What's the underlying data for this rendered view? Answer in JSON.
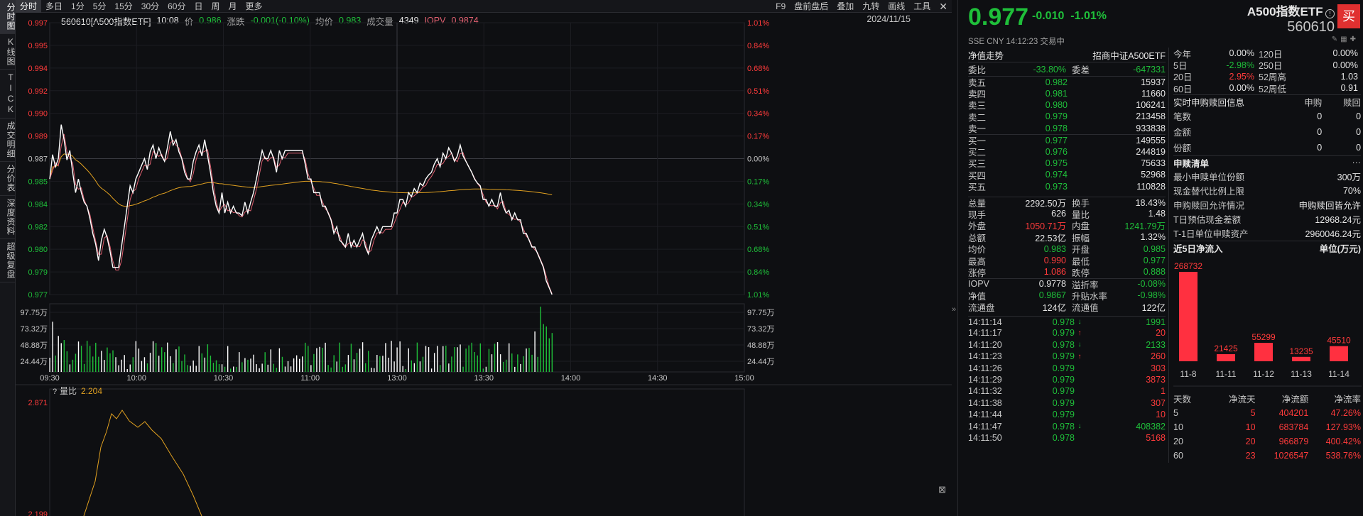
{
  "vtabs": [
    "分时图",
    "K线图",
    "TICK",
    "成交明细",
    "分价表",
    "深度资料",
    "超级复盘"
  ],
  "toolbar": {
    "left": [
      "分时",
      "多日",
      "1分",
      "5分",
      "15分",
      "30分",
      "60分",
      "日",
      "周",
      "月",
      "更多"
    ],
    "right": [
      "F9",
      "盘前盘后",
      "叠加",
      "九转",
      "画线",
      "工具"
    ],
    "close_icon": "close-icon"
  },
  "info": {
    "code_name": "560610[A500指数ETF]",
    "time": "10:08",
    "price_label": "价",
    "price": "0.986",
    "change_label": "涨跌",
    "change": "-0.001(-0.10%)",
    "avg_label": "均价",
    "avg": "0.983",
    "volume_label": "成交量",
    "volume": "4349",
    "iopv_label": "IOPV",
    "iopv": "0.9874",
    "date": "2024/11/15"
  },
  "chart_data": {
    "type": "line",
    "price_axis": [
      "0.997",
      "0.995",
      "0.994",
      "0.992",
      "0.990",
      "0.989",
      "0.987",
      "0.985",
      "0.984",
      "0.982",
      "0.980",
      "0.979",
      "0.977"
    ],
    "pct_axis": [
      "1.01%",
      "0.84%",
      "0.68%",
      "0.51%",
      "0.34%",
      "0.17%",
      "0.00%",
      "0.17%",
      "0.34%",
      "0.51%",
      "0.68%",
      "0.84%",
      "1.01%"
    ],
    "ylim": [
      0.977,
      0.997
    ],
    "prev_close": 0.987,
    "volume_axis": [
      "97.75万",
      "73.32万",
      "48.88万",
      "24.44万"
    ],
    "time_axis": [
      "09:30",
      "10:00",
      "10:30",
      "11:00",
      "13:00",
      "13:30",
      "14:00",
      "14:30",
      "15:00"
    ],
    "series": [
      {
        "name": "价格",
        "color": "#ffffff"
      },
      {
        "name": "IOPV",
        "color": "#e06070"
      },
      {
        "name": "均价",
        "color": "#e0a020"
      }
    ],
    "price": [
      0.9855,
      0.9873,
      0.9864,
      0.987,
      0.9895,
      0.9884,
      0.9869,
      0.9876,
      0.986,
      0.9845,
      0.9855,
      0.9845,
      0.9838,
      0.9835,
      0.9826,
      0.9815,
      0.9807,
      0.9795,
      0.981,
      0.9818,
      0.9812,
      0.9802,
      0.979,
      0.979,
      0.979,
      0.9805,
      0.982,
      0.9835,
      0.985,
      0.9845,
      0.9855,
      0.986,
      0.9865,
      0.987,
      0.9862,
      0.9875,
      0.988,
      0.987,
      0.9878,
      0.9872,
      0.9868,
      0.9878,
      0.989,
      0.988,
      0.9884,
      0.9875,
      0.987,
      0.986,
      0.9855,
      0.9855,
      0.9868,
      0.9875,
      0.988,
      0.9872,
      0.9884,
      0.9872,
      0.986,
      0.9845,
      0.9835,
      0.983,
      0.9845,
      0.983,
      0.9838,
      0.983,
      0.9835,
      0.983,
      0.983,
      0.9828,
      0.9838,
      0.983,
      0.9838,
      0.9845,
      0.9855,
      0.9866,
      0.9876,
      0.987,
      0.987,
      0.9876,
      0.987,
      0.986,
      0.9876,
      0.987,
      0.9876,
      0.9876,
      0.9876,
      0.9876,
      0.9876,
      0.9876,
      0.9876,
      0.9866,
      0.9855,
      0.9855,
      0.9845,
      0.9845,
      0.9845,
      0.9835,
      0.9835,
      0.983,
      0.9825,
      0.9815,
      0.982,
      0.981,
      0.9808,
      0.9805,
      0.9815,
      0.9805,
      0.981,
      0.9805,
      0.981,
      0.9815,
      0.9805,
      0.98,
      0.981,
      0.9815,
      0.982,
      0.9815,
      0.982,
      0.982,
      0.982,
      0.982,
      0.983,
      0.983,
      0.984,
      0.984,
      0.9835,
      0.9845,
      0.9842,
      0.9848,
      0.9845,
      0.9852,
      0.985,
      0.9855,
      0.9858,
      0.986,
      0.9866,
      0.987,
      0.9864,
      0.9874,
      0.987,
      0.9878,
      0.9874,
      0.9868,
      0.9872,
      0.988,
      0.9872,
      0.9868,
      0.9864,
      0.986,
      0.9855,
      0.9852,
      0.985,
      0.984,
      0.984,
      0.9835,
      0.984,
      0.9835,
      0.9835,
      0.9845,
      0.9835,
      0.983,
      0.9832,
      0.9825,
      0.983,
      0.9825,
      0.9825,
      0.9815,
      0.9815,
      0.981,
      0.9805,
      0.9805,
      0.98,
      0.9795,
      0.979,
      0.978,
      0.9775,
      0.977
    ],
    "volume_note": "bars shown in lower pane"
  },
  "subchart": {
    "label": "量比",
    "value": "2.204",
    "axis": [
      "2.871",
      "2.199"
    ]
  },
  "right": {
    "price": "0.977",
    "change": "-0.010",
    "change_pct": "-1.01%",
    "name": "A500指数ETF",
    "info_icon": "info-icon",
    "code": "560610",
    "buy_label": "买",
    "meta": "SSE  CNY  14:12:23  交易中",
    "nav_trend_label": "净值走势",
    "fund_name": "招商中证A500ETF",
    "weibi": {
      "k1": "委比",
      "v1": "-33.80%",
      "k2": "委差",
      "v2": "-647331"
    },
    "sells": [
      {
        "label": "卖五",
        "price": "0.982",
        "vol": "15937"
      },
      {
        "label": "卖四",
        "price": "0.981",
        "vol": "11660"
      },
      {
        "label": "卖三",
        "price": "0.980",
        "vol": "106241"
      },
      {
        "label": "卖二",
        "price": "0.979",
        "vol": "213458"
      },
      {
        "label": "卖一",
        "price": "0.978",
        "vol": "933838"
      }
    ],
    "buys": [
      {
        "label": "买一",
        "price": "0.977",
        "vol": "149555"
      },
      {
        "label": "买二",
        "price": "0.976",
        "vol": "244819"
      },
      {
        "label": "买三",
        "price": "0.975",
        "vol": "75633"
      },
      {
        "label": "买四",
        "price": "0.974",
        "vol": "52968"
      },
      {
        "label": "买五",
        "price": "0.973",
        "vol": "110828"
      }
    ],
    "stats": [
      {
        "k1": "总量",
        "v1": "2292.50万",
        "c1": "white",
        "k2": "换手",
        "v2": "18.43%",
        "c2": "white"
      },
      {
        "k1": "现手",
        "v1": "626",
        "c1": "white",
        "k2": "量比",
        "v2": "1.48",
        "c2": "white"
      },
      {
        "k1": "外盘",
        "v1": "1050.71万",
        "c1": "red",
        "k2": "内盘",
        "v2": "1241.79万",
        "c2": "green"
      },
      {
        "k1": "总额",
        "v1": "22.53亿",
        "c1": "white",
        "k2": "振幅",
        "v2": "1.32%",
        "c2": "white"
      },
      {
        "k1": "均价",
        "v1": "0.983",
        "c1": "green",
        "k2": "开盘",
        "v2": "0.985",
        "c2": "green"
      },
      {
        "k1": "最高",
        "v1": "0.990",
        "c1": "red",
        "k2": "最低",
        "v2": "0.977",
        "c2": "green"
      },
      {
        "k1": "涨停",
        "v1": "1.086",
        "c1": "red",
        "k2": "跌停",
        "v2": "0.888",
        "c2": "green"
      }
    ],
    "stats2": [
      {
        "k1": "IOPV",
        "v1": "0.9778",
        "c1": "white",
        "k2": "溢折率",
        "v2": "-0.08%",
        "c2": "green"
      },
      {
        "k1": "净值",
        "v1": "0.9867",
        "c1": "green",
        "k2": "升贴水率",
        "v2": "-0.98%",
        "c2": "green"
      },
      {
        "k1": "流通盘",
        "v1": "124亿",
        "c1": "white",
        "k2": "流通值",
        "v2": "122亿",
        "c2": "white"
      }
    ],
    "ticks": [
      {
        "time": "14:11:14",
        "price": "0.978",
        "arrow": "↓",
        "ac": "green",
        "vol": "1991",
        "vc": "green"
      },
      {
        "time": "14:11:17",
        "price": "0.979",
        "arrow": "↑",
        "ac": "red",
        "vol": "20",
        "vc": "red"
      },
      {
        "time": "14:11:20",
        "price": "0.978",
        "arrow": "↓",
        "ac": "green",
        "vol": "2133",
        "vc": "green"
      },
      {
        "time": "14:11:23",
        "price": "0.979",
        "arrow": "↑",
        "ac": "red",
        "vol": "260",
        "vc": "red"
      },
      {
        "time": "14:11:26",
        "price": "0.979",
        "arrow": "",
        "ac": "red",
        "vol": "303",
        "vc": "red"
      },
      {
        "time": "14:11:29",
        "price": "0.979",
        "arrow": "",
        "ac": "red",
        "vol": "3873",
        "vc": "red"
      },
      {
        "time": "14:11:32",
        "price": "0.979",
        "arrow": "",
        "ac": "red",
        "vol": "1",
        "vc": "red"
      },
      {
        "time": "14:11:38",
        "price": "0.979",
        "arrow": "",
        "ac": "red",
        "vol": "307",
        "vc": "red"
      },
      {
        "time": "14:11:44",
        "price": "0.979",
        "arrow": "",
        "ac": "red",
        "vol": "10",
        "vc": "red"
      },
      {
        "time": "14:11:47",
        "price": "0.978",
        "arrow": "↓",
        "ac": "green",
        "vol": "408382",
        "vc": "green"
      },
      {
        "time": "14:11:50",
        "price": "0.978",
        "arrow": "",
        "ac": "green",
        "vol": "5168",
        "vc": "red"
      }
    ],
    "periods": [
      {
        "a": "今年",
        "b": "0.00%",
        "bc": "white",
        "c": "120日",
        "d": "0.00%",
        "dc": "white"
      },
      {
        "a": "5日",
        "b": "-2.98%",
        "bc": "green",
        "c": "250日",
        "d": "0.00%",
        "dc": "white"
      },
      {
        "a": "20日",
        "b": "2.95%",
        "bc": "red",
        "c": "52周高",
        "d": "1.03",
        "dc": "white"
      },
      {
        "a": "60日",
        "b": "0.00%",
        "bc": "white",
        "c": "52周低",
        "d": "0.91",
        "dc": "white"
      }
    ],
    "realtime": {
      "title": "实时申购赎回信息",
      "col1": "申购",
      "col2": "赎回",
      "rows": [
        {
          "a": "笔数",
          "b": "0",
          "c": "0"
        },
        {
          "a": "金额",
          "b": "0",
          "c": "0"
        },
        {
          "a": "份额",
          "b": "0",
          "c": "0"
        }
      ]
    },
    "creation": {
      "title": "申赎清单",
      "more": "···",
      "rows": [
        {
          "a": "最小申赎单位份额",
          "b": "300万"
        },
        {
          "a": "现金替代比例上限",
          "b": "70%"
        },
        {
          "a": "申购赎回允许情况",
          "b": "申购赎回皆允许"
        },
        {
          "a": "T日预估现金差额",
          "b": "12968.24元"
        },
        {
          "a": "T-1日单位申赎资产",
          "b": "2960046.24元"
        }
      ]
    },
    "inflow": {
      "title": "近5日净流入",
      "unit": "单位(万元)",
      "bars": [
        {
          "date": "11-8",
          "value": 268732
        },
        {
          "date": "11-11",
          "value": 21425
        },
        {
          "date": "11-12",
          "value": 55299
        },
        {
          "date": "11-13",
          "value": 13235
        },
        {
          "date": "11-14",
          "value": 45510
        }
      ],
      "table_head": [
        "天数",
        "净流天",
        "净流额",
        "净流率"
      ],
      "table": [
        {
          "a": "5",
          "b": "5",
          "c": "404201",
          "d": "47.26%"
        },
        {
          "a": "10",
          "b": "10",
          "c": "683784",
          "d": "127.93%"
        },
        {
          "a": "20",
          "b": "20",
          "c": "966879",
          "d": "400.42%"
        },
        {
          "a": "60",
          "b": "23",
          "c": "1026547",
          "d": "538.76%"
        }
      ]
    }
  },
  "colors": {
    "up": "#ff3b3b",
    "down": "#1fbf3a",
    "bg": "#0e0f12"
  }
}
